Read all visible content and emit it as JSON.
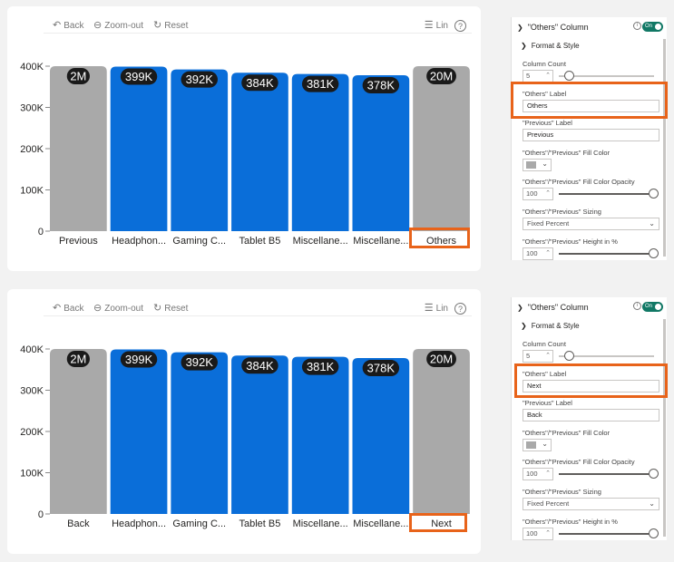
{
  "toolbar": {
    "back_label": "Back",
    "zoom_label": "Zoom-out",
    "reset_label": "Reset",
    "lin_label": "Lin",
    "help_label": "?"
  },
  "chart_data": [
    {
      "type": "bar",
      "categories": [
        "Previous",
        "Headphon...",
        "Gaming C...",
        "Tablet B5",
        "Miscellane...",
        "Miscellane...",
        "Others"
      ],
      "values": [
        400000,
        399000,
        392000,
        384000,
        381000,
        378000,
        400000
      ],
      "value_labels": [
        "2M",
        "399K",
        "392K",
        "384K",
        "381K",
        "378K",
        "20M"
      ],
      "bar_colors": [
        "#a9a9a9",
        "#0a6ed9",
        "#0a6ed9",
        "#0a6ed9",
        "#0a6ed9",
        "#0a6ed9",
        "#a9a9a9"
      ],
      "yticks": [
        "0",
        "100K",
        "200K",
        "300K",
        "400K"
      ],
      "ylim": [
        0,
        400000
      ],
      "highlighted_category": "Others",
      "grid": false
    },
    {
      "type": "bar",
      "categories": [
        "Back",
        "Headphon...",
        "Gaming C...",
        "Tablet B5",
        "Miscellane...",
        "Miscellane...",
        "Next"
      ],
      "values": [
        400000,
        399000,
        392000,
        384000,
        381000,
        378000,
        400000
      ],
      "value_labels": [
        "2M",
        "399K",
        "392K",
        "384K",
        "381K",
        "378K",
        "20M"
      ],
      "bar_colors": [
        "#a9a9a9",
        "#0a6ed9",
        "#0a6ed9",
        "#0a6ed9",
        "#0a6ed9",
        "#0a6ed9",
        "#a9a9a9"
      ],
      "yticks": [
        "0",
        "100K",
        "200K",
        "300K",
        "400K"
      ],
      "ylim": [
        0,
        400000
      ],
      "highlighted_category": "Next",
      "grid": false
    }
  ],
  "panels": [
    {
      "title": "\"Others\" Column",
      "info_icon": "i",
      "toggle_label": "On",
      "section": "Format & Style",
      "column_count_label": "Column Count",
      "column_count_value": "5",
      "others_label_label": "\"Others\" Label",
      "others_label_value": "Others",
      "previous_label_label": "\"Previous\" Label",
      "previous_label_value": "Previous",
      "fill_color_label": "\"Others\"/\"Previous\" Fill Color",
      "fill_color": "#a9a9a9",
      "opacity_label": "\"Others\"/\"Previous\" Fill Color Opacity",
      "opacity_value": "100",
      "sizing_label": "\"Others\"/\"Previous\" Sizing",
      "sizing_value": "Fixed Percent",
      "height_label": "\"Others\"/\"Previous\" Height in %",
      "height_value": "100"
    },
    {
      "title": "\"Others\" Column",
      "info_icon": "i",
      "toggle_label": "On",
      "section": "Format & Style",
      "column_count_label": "Column Count",
      "column_count_value": "5",
      "others_label_label": "\"Others\" Label",
      "others_label_value": "Next",
      "previous_label_label": "\"Previous\" Label",
      "previous_label_value": "Back",
      "fill_color_label": "\"Others\"/\"Previous\" Fill Color",
      "fill_color": "#a9a9a9",
      "opacity_label": "\"Others\"/\"Previous\" Fill Color Opacity",
      "opacity_value": "100",
      "sizing_label": "\"Others\"/\"Previous\" Sizing",
      "sizing_value": "Fixed Percent",
      "height_label": "\"Others\"/\"Previous\" Height in %",
      "height_value": "100"
    }
  ],
  "colors": {
    "accent_highlight": "#e8631a",
    "bar_blue": "#0a6ed9",
    "bar_gray": "#a9a9a9",
    "toggle_on": "#117865"
  }
}
